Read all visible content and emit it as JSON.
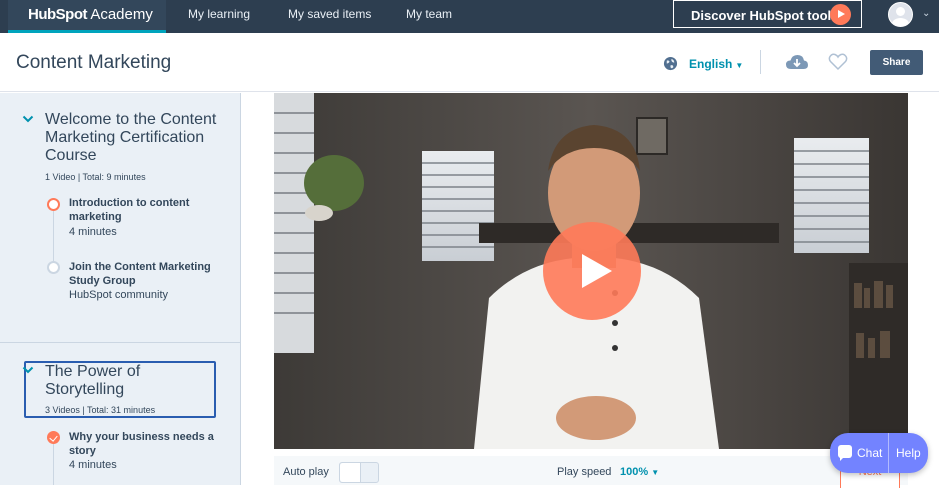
{
  "nav": {
    "brand_prefix": "HubSpot",
    "brand_suffix": "Academy",
    "links": [
      "My learning",
      "My saved items",
      "My team"
    ],
    "discover_label": "Discover HubSpot tools"
  },
  "header": {
    "title": "Content Marketing",
    "language": "English",
    "share_label": "Share"
  },
  "sidebar": {
    "sections": [
      {
        "title": "Welcome to the Content Marketing Certification Course",
        "meta": "1 Video | Total: 9 minutes",
        "lessons": [
          {
            "title": "Introduction to content marketing",
            "sub": "4 minutes",
            "status": "in-progress"
          },
          {
            "title": "Join the Content Marketing Study Group",
            "sub": "HubSpot community",
            "status": "not-started"
          }
        ]
      },
      {
        "title": "The Power of Storytelling",
        "meta": "3 Videos | Total: 31 minutes",
        "lessons": [
          {
            "title": "Why your business needs a story",
            "sub": "4 minutes",
            "status": "completed"
          }
        ]
      }
    ]
  },
  "player": {
    "autoplay_label": "Auto play",
    "speed_label": "Play speed",
    "speed_value": "100%",
    "next_label": "Next"
  },
  "chat": {
    "chat_label": "Chat",
    "help_label": "Help"
  },
  "colors": {
    "nav_bg": "#2d3e50",
    "accent_orange": "#ff7a59",
    "link_teal": "#0091ae",
    "sidebar_bg": "#eaf0f6",
    "chat_purple": "#7383ff"
  }
}
